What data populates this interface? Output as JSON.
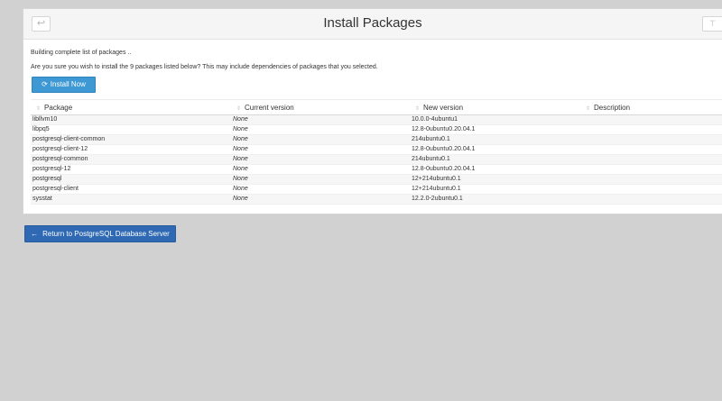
{
  "header": {
    "title": "Install Packages",
    "back_icon": "↩",
    "filter_icon": "⊤"
  },
  "messages": {
    "building": "Building complete list of packages ..",
    "confirm": "Are you sure you wish to install the 9 packages listed below? This may include dependencies of packages that you selected."
  },
  "install_button": {
    "icon": "⟳",
    "label": "Install Now"
  },
  "table": {
    "columns": [
      "Package",
      "Current version",
      "New version",
      "Description"
    ],
    "rows": [
      {
        "package": "libllvm10",
        "current": "None",
        "new": "10.0.0-4ubuntu1",
        "description": ""
      },
      {
        "package": "libpq5",
        "current": "None",
        "new": "12.8-0ubuntu0.20.04.1",
        "description": ""
      },
      {
        "package": "postgresql-client-common",
        "current": "None",
        "new": "214ubuntu0.1",
        "description": ""
      },
      {
        "package": "postgresql-client-12",
        "current": "None",
        "new": "12.8-0ubuntu0.20.04.1",
        "description": ""
      },
      {
        "package": "postgresql-common",
        "current": "None",
        "new": "214ubuntu0.1",
        "description": ""
      },
      {
        "package": "postgresql-12",
        "current": "None",
        "new": "12.8-0ubuntu0.20.04.1",
        "description": ""
      },
      {
        "package": "postgresql",
        "current": "None",
        "new": "12+214ubuntu0.1",
        "description": ""
      },
      {
        "package": "postgresql-client",
        "current": "None",
        "new": "12+214ubuntu0.1",
        "description": ""
      },
      {
        "package": "sysstat",
        "current": "None",
        "new": "12.2.0-2ubuntu0.1",
        "description": ""
      }
    ]
  },
  "return_button": {
    "icon": "←",
    "label": "Return to PostgreSQL Database Server"
  }
}
